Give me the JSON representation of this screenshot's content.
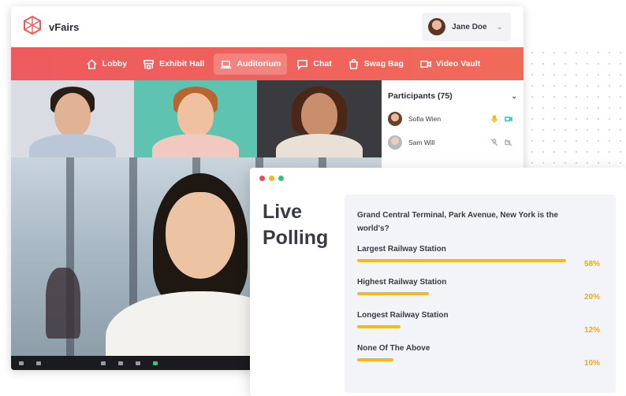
{
  "app": {
    "brand": "vFairs",
    "user_name": "Jane Doe"
  },
  "nav": {
    "items": [
      {
        "label": "Lobby",
        "icon": "home-icon"
      },
      {
        "label": "Exhibit Hall",
        "icon": "booth-icon"
      },
      {
        "label": "Auditorium",
        "icon": "laptop-icon",
        "active": true
      },
      {
        "label": "Chat",
        "icon": "chat-icon"
      },
      {
        "label": "Swag Bag",
        "icon": "bag-icon"
      },
      {
        "label": "Video Vault",
        "icon": "video-icon"
      }
    ]
  },
  "participants": {
    "title": "Participants (75)",
    "people": [
      {
        "name": "Sofia Wien",
        "mic": "on",
        "camera": "on"
      },
      {
        "name": "Sam Will",
        "mic": "muted",
        "camera": "off"
      }
    ]
  },
  "poll": {
    "heading_line1": "Live",
    "heading_line2": "Polling",
    "question": "Grand Central Terminal, Park Avenue, New York is the world's?",
    "options": [
      {
        "label": "Largest Railway Station",
        "percent": 58,
        "percent_label": "58%"
      },
      {
        "label": "Highest Railway Station",
        "percent": 20,
        "percent_label": "20%"
      },
      {
        "label": "Longest Railway Station",
        "percent": 12,
        "percent_label": "12%"
      },
      {
        "label": "None Of The Above",
        "percent": 10,
        "percent_label": "10%"
      }
    ]
  },
  "colors": {
    "nav_gradient_start": "#ee5a5e",
    "nav_gradient_end": "#f06a5a",
    "poll_bar": "#f6b820",
    "poll_percent": "#f0a81a",
    "brand_logo": "#ef5a5e"
  }
}
